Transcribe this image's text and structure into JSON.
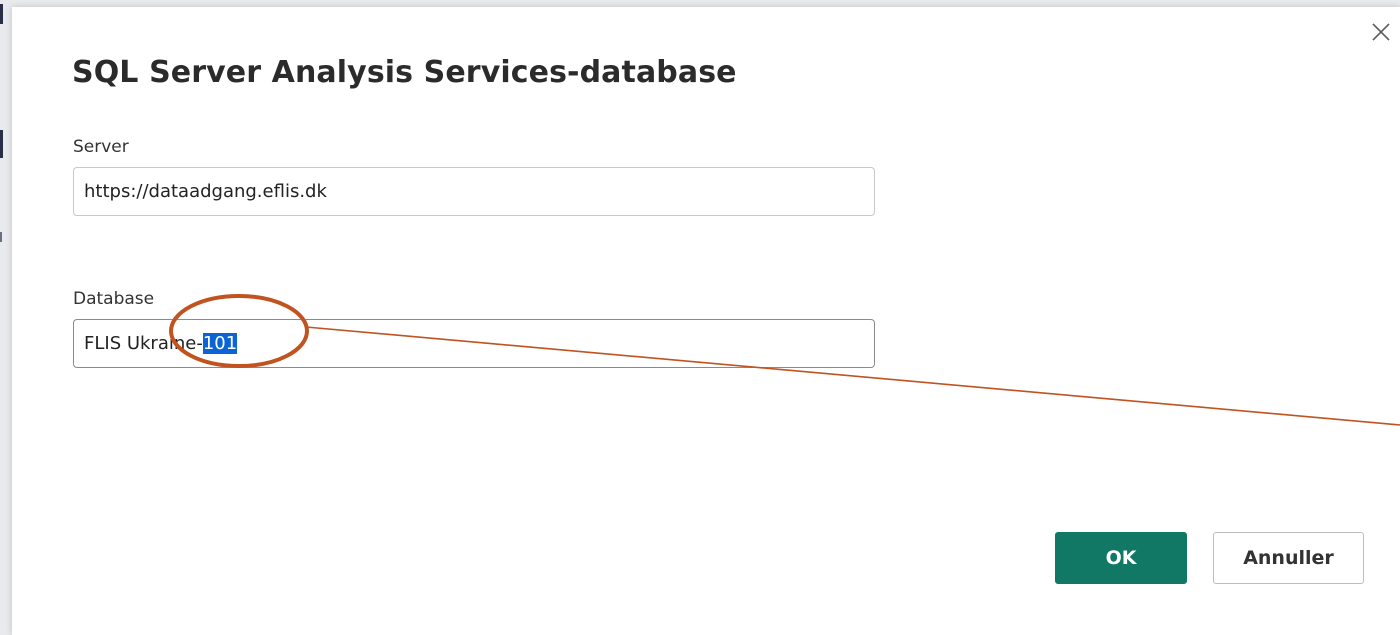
{
  "dialog": {
    "title": "SQL Server Analysis Services-database",
    "close_icon": "close-icon"
  },
  "server": {
    "label": "Server",
    "value": "https://dataadgang.eflis.dk"
  },
  "database": {
    "label": "Database",
    "value_prefix": "FLIS Ukraine-",
    "value_selected": "101"
  },
  "buttons": {
    "ok_label": "OK",
    "cancel_label": "Annuller"
  },
  "colors": {
    "ok_button": "#117865",
    "selection": "#0b63d4",
    "annotation": "#c0531f"
  }
}
